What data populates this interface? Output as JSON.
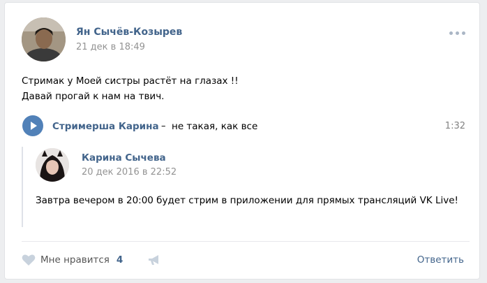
{
  "post": {
    "author_name": "Ян Сычёв-Козырев",
    "date": "21 дек в 18:49",
    "text_lines": [
      "Стримак у Моей систры растёт на глазах !!",
      "Давай прогай к нам на твич."
    ]
  },
  "audio": {
    "artist": "Стримерша Карина",
    "separator": "–",
    "title": "не такая, как все",
    "duration": "1:32"
  },
  "repost": {
    "author_name": "Карина Сычева",
    "date": "20 дек 2016 в 22:52",
    "text": "Завтра вечером в 20:00 будет стрим в приложении для прямых трансляций VK Live!"
  },
  "footer": {
    "like_label": "Мне нравится",
    "like_count": "4",
    "reply_label": "Ответить"
  },
  "icons": {
    "more": "more-dots-icon",
    "play": "play-icon",
    "like": "heart-icon",
    "share": "megaphone-icon"
  },
  "colors": {
    "link": "#42648b",
    "accent": "#5181b8",
    "muted": "#939393"
  }
}
